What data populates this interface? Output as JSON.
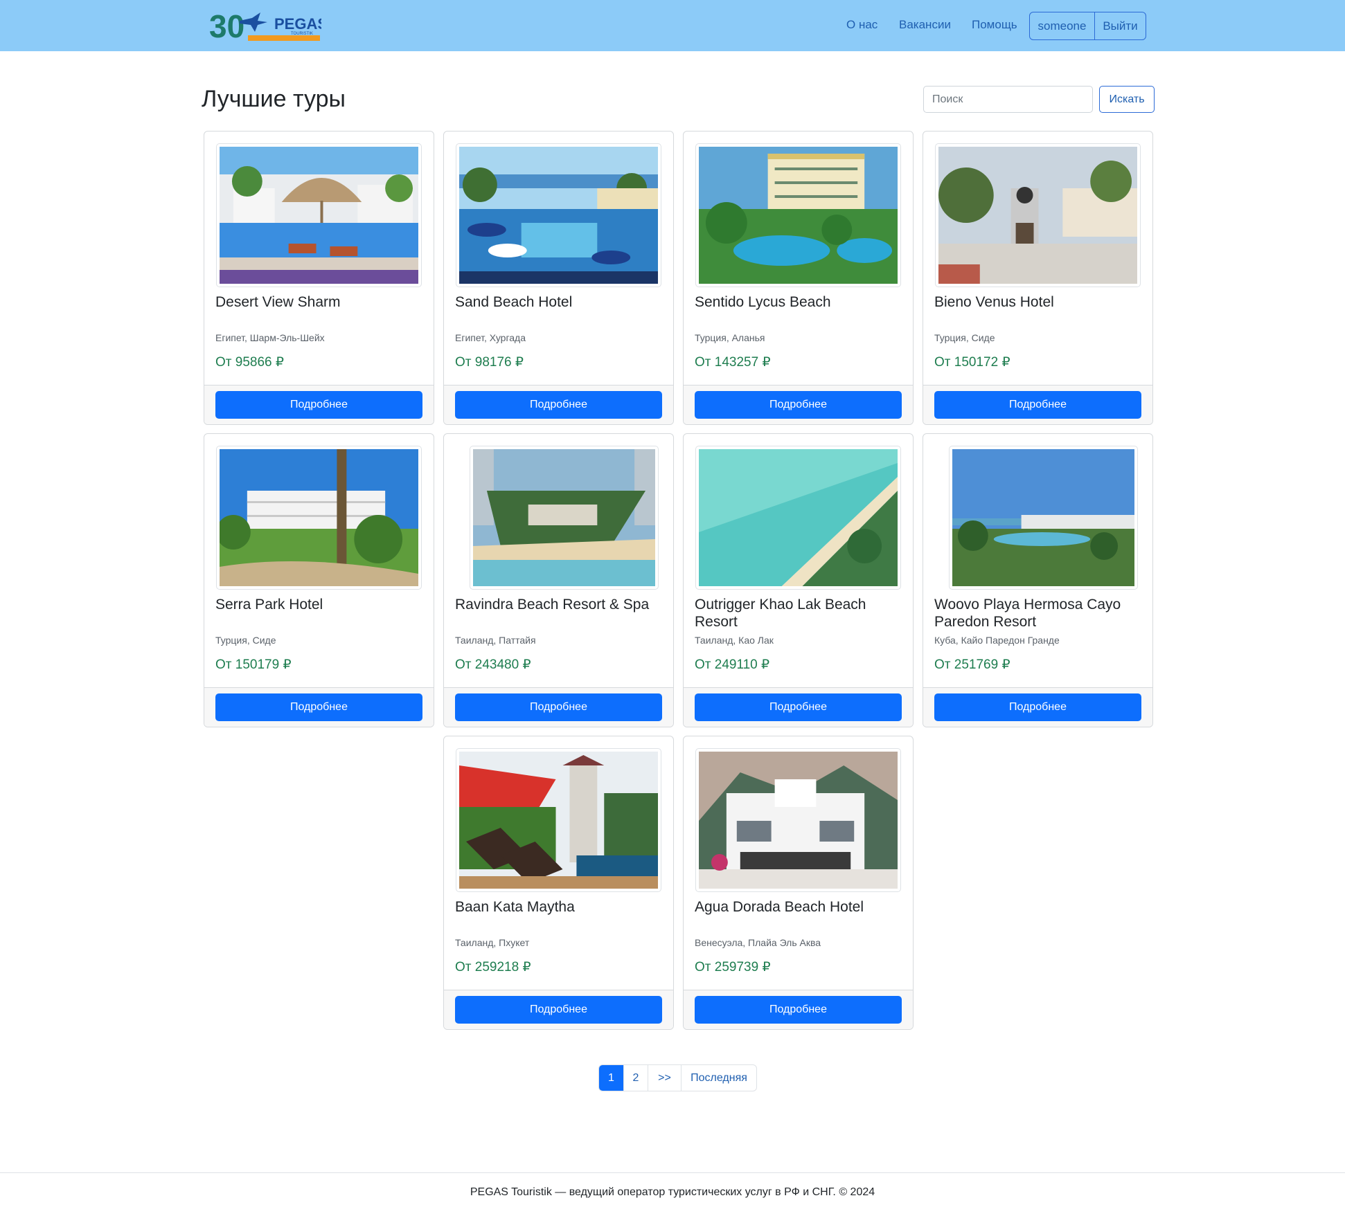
{
  "header": {
    "logo_alt": "PEGAS Touristik",
    "logo_number": "30",
    "logo_brand": "PEGAS",
    "logo_sub": "TOURISTIK",
    "nav": [
      "О нас",
      "Вакансии",
      "Помощь"
    ],
    "user": "someone",
    "logout": "Выйти",
    "color": "#8ccbf8"
  },
  "main": {
    "title": "Лучшие туры",
    "search": {
      "placeholder": "Поиск",
      "button": "Искать"
    }
  },
  "tours": [
    {
      "name": "Desert View Sharm",
      "location": "Египет, Шарм-Эль-Шейх",
      "price": "От 95866 ₽",
      "button": "Подробнее",
      "image": "pool-umbrellas"
    },
    {
      "name": "Sand Beach Hotel",
      "location": "Египет, Хургада",
      "price": "От 98176 ₽",
      "button": "Подробнее",
      "image": "resort-pool"
    },
    {
      "name": "Sentido Lycus Beach",
      "location": "Турция, Аланья",
      "price": "От 143257 ₽",
      "button": "Подробнее",
      "image": "hotel-building"
    },
    {
      "name": "Bieno Venus Hotel",
      "location": "Турция, Сиде",
      "price": "От 150172 ₽",
      "button": "Подробнее",
      "image": "hotel-entrance"
    },
    {
      "name": "Serra Park Hotel",
      "location": "Турция, Сиде",
      "price": "От 150179 ₽",
      "button": "Подробнее",
      "image": "hotel-garden"
    },
    {
      "name": "Ravindra Beach Resort & Spa",
      "location": "Таиланд, Паттайя",
      "price": "От 243480 ₽",
      "button": "Подробнее",
      "image": "aerial-resort"
    },
    {
      "name": "Outrigger Khao Lak Beach Resort",
      "location": "Таиланд, Као Лак",
      "price": "От 249110 ₽",
      "button": "Подробнее",
      "image": "aerial-beach"
    },
    {
      "name": "Woovo Playa Hermosa Cayo Paredon Resort",
      "location": "Куба, Кайо Паредон Гранде",
      "price": "От 251769 ₽",
      "button": "Подробнее",
      "image": "resort-palms"
    },
    {
      "name": "Baan Kata Maytha",
      "location": "Таиланд, Пхукет",
      "price": "От 259218 ₽",
      "button": "Подробнее",
      "image": "poolside-loungers"
    },
    {
      "name": "Agua Dorada Beach Hotel",
      "location": "Венесуэла, Плайа Эль Аква",
      "price": "От 259739 ₽",
      "button": "Подробнее",
      "image": "hotel-mountains"
    }
  ],
  "pagination": {
    "pages": [
      "1",
      "2"
    ],
    "next": ">>",
    "last": "Последняя",
    "active": "1"
  },
  "footer": {
    "text": "PEGAS Touristik — ведущий оператор туристических услуг в РФ и СНГ. © 2024"
  },
  "colors": {
    "primary": "#0d6efd",
    "price": "#1e7d4f"
  }
}
